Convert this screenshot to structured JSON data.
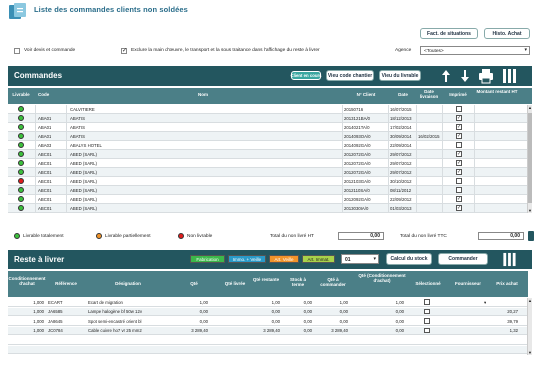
{
  "header": {
    "title": "Liste des commandes clients non soldées",
    "btn_fact": "Fact. de situations",
    "btn_histo": "Histo. Achat"
  },
  "filters": {
    "voir_devis": "Voir devis et commande",
    "exclure": "Exclure la main d'œuvre, le transport et la sous traitance dans l'affichage du reste à livrer",
    "agence_label": "Agence",
    "agence_value": "<Toutes>"
  },
  "commandes": {
    "title": "Commandes",
    "btn_client_en_cours": "Client en cours",
    "btn_vieu_code": "Vieu code chantier",
    "btn_vieu_livrable": "Vieu du livrable",
    "columns": [
      "Livrable",
      "Code",
      "Nom",
      "N° Client",
      "Date",
      "Date livraison",
      "Imprimé",
      "Montant restant HT"
    ],
    "rows": [
      {
        "status": "g",
        "code": "",
        "nom": "CALVITIERE",
        "client": "20150716",
        "date": "16/07/2015",
        "livraison": "",
        "imprime": false
      },
      {
        "status": "g",
        "code": "ABA01",
        "nom": "ABATIS",
        "client": "2013121BA/0",
        "date": "18/12/2013",
        "livraison": "",
        "imprime": true
      },
      {
        "status": "g",
        "code": "ABA01",
        "nom": "ABATIS",
        "client": "2014021TA/0",
        "date": "17/02/2014",
        "livraison": "",
        "imprime": true
      },
      {
        "status": "g",
        "code": "ABA01",
        "nom": "ABATIS",
        "client": "2014093OA/0",
        "date": "30/09/2014",
        "livraison": "16/02/2015",
        "imprime": true
      },
      {
        "status": "g",
        "code": "ABA03",
        "nom": "ABALYS HOTEL",
        "client": "2014092GA/0",
        "date": "22/09/2014",
        "livraison": "",
        "imprime": false
      },
      {
        "status": "g",
        "code": "ABC01",
        "nom": "ABED (SARL)",
        "client": "2012072GA/0",
        "date": "29/07/2012",
        "livraison": "",
        "imprime": true
      },
      {
        "status": "g",
        "code": "ABC01",
        "nom": "ABED (SARL)",
        "client": "2012072GA/0",
        "date": "29/07/2012",
        "livraison": "",
        "imprime": true
      },
      {
        "status": "g",
        "code": "ABC01",
        "nom": "ABED (SARL)",
        "client": "2012072GA/0",
        "date": "29/07/2012",
        "livraison": "",
        "imprime": true
      },
      {
        "status": "r",
        "code": "ABC01",
        "nom": "ABED (SARL)",
        "client": "2012103GA/0",
        "date": "30/10/2012",
        "livraison": "",
        "imprime": false
      },
      {
        "status": "g",
        "code": "ABC01",
        "nom": "ABED (SARL)",
        "client": "2012110SA/0",
        "date": "08/11/2012",
        "livraison": "",
        "imprime": false
      },
      {
        "status": "g",
        "code": "ABC01",
        "nom": "ABED (SARL)",
        "client": "2012092GA/0",
        "date": "22/09/2012",
        "livraison": "",
        "imprime": true
      },
      {
        "status": "g",
        "code": "ABC01",
        "nom": "ABED (SARL)",
        "client": "2013030IA/0",
        "date": "01/03/2013",
        "livraison": "",
        "imprime": true
      }
    ]
  },
  "legend": {
    "total": "Livrable totalement",
    "partiel": "Livrable partiellement",
    "non": "Non livrable",
    "total_ht_label": "Total du non livré HT",
    "total_ht": "0,00",
    "total_ttc_label": "Total du non livré TTC",
    "total_ttc": "0,00"
  },
  "reste": {
    "title": "Reste à livrer",
    "tag_fab": "Fabrication",
    "tag_immo": "Immo. + Veille",
    "tag_artv": "Art. Veille",
    "tag_artimm": "Art. Immat.",
    "select_val": "01",
    "btn_calcul": "Calcul du stock",
    "btn_commander": "Commander",
    "columns": [
      "Conditionnement d'achat",
      "Référence",
      "Désignation",
      "Qté",
      "Qté livrée",
      "Qté restante",
      "Stock à terme",
      "Qté à commander",
      "Qté (Conditionnement d'achat)",
      "Sélectionné",
      "Fournisseur",
      "Prix achat"
    ],
    "rows": [
      {
        "cond": "1,000",
        "ref": "ECART",
        "des": "Ecart de migration",
        "qte": "1,00",
        "livree": "",
        "restante": "1,00",
        "stock": "0,00",
        "acmd": "1,00",
        "qcond": "1,00",
        "four": "",
        "prix": ""
      },
      {
        "cond": "1,000",
        "ref": "JA6585",
        "des": "Lampe halogène bf 50w 12v",
        "qte": "0,00",
        "livree": "",
        "restante": "0,00",
        "stock": "0,00",
        "acmd": "0,00",
        "qcond": "0,00",
        "four": "",
        "prix": "20,27"
      },
      {
        "cond": "1,000",
        "ref": "JA8645",
        "des": "Spot semi-encastré orient bl",
        "qte": "0,00",
        "livree": "",
        "restante": "0,00",
        "stock": "0,00",
        "acmd": "0,00",
        "qcond": "0,00",
        "four": "",
        "prix": "39,79"
      },
      {
        "cond": "1,000",
        "ref": "JC0784",
        "des": "Cable cuivre ho7 vr 25 mm2",
        "qte": "3 289,40",
        "livree": "",
        "restante": "3 289,40",
        "stock": "0,00",
        "acmd": "3 289,40",
        "qcond": "0,00",
        "four": "",
        "prix": "1,32"
      }
    ]
  },
  "colors": {
    "header_bg": "#23565f",
    "col_bg": "#4b7f87",
    "green": "#3cc03c",
    "orange": "#f0932a",
    "red": "#e01c1c"
  }
}
